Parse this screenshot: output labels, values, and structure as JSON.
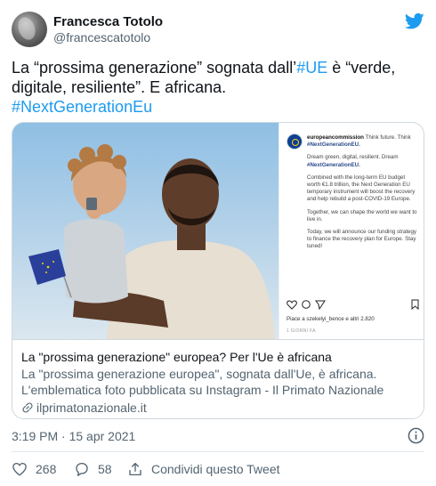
{
  "author": {
    "display_name": "Francesca Totolo",
    "handle": "@francescatotolo"
  },
  "tweet": {
    "text_before": "La “prossima generazione” sognata dall’",
    "hashtag_ue": "#UE",
    "text_after": " è “verde, digitale, resiliente”. E africana.",
    "hashtag_ngeu": "#NextGenerationEu"
  },
  "card": {
    "title": "La \"prossima generazione\" europea? Per l'Ue è africana",
    "description_line1": "La \"prossima generazione europea\", sognata dall'Ue, è africana.",
    "description_line2": "L'emblematica foto pubblicata su Instagram - Il Primato Nazionale",
    "domain": "ilprimatonazionale.it",
    "instagram": {
      "username": "europeancommission",
      "caption_intro": "Think future. Think",
      "caption_tag": "#NextGenerationEU.",
      "p2": "Dream green, digital, resilient. Dream",
      "p2_tag": "#NextGenerationEU.",
      "p3": "Combined with the long-term EU budget worth €1.8 trillion, the Next Generation EU temporary instrument will boost the recovery and help rebuild a post-COVID-19 Europe.",
      "p4": "Together, we can shape the world we want to live in.",
      "p5": "Today, we will announce our funding strategy to finance the recovery plan for Europe. Stay tuned!",
      "likes": "Piace a szekelyi_bence e altri 2.820",
      "date": "1 GIORNI FA"
    }
  },
  "timestamp": "3:19 PM · 15 apr 2021",
  "actions": {
    "like_count": "268",
    "reply_count": "58",
    "share_label": "Condividi questo Tweet"
  },
  "colors": {
    "link": "#1d9bf0",
    "twitter_blue": "#1d9bf0",
    "secondary_text": "#536471",
    "border": "#cfd9de"
  },
  "icons": {
    "brand": "twitter-bird-icon",
    "info": "info-icon",
    "like": "heart-icon",
    "reply": "reply-bubble-icon",
    "share": "share-icon",
    "link": "link-icon"
  }
}
